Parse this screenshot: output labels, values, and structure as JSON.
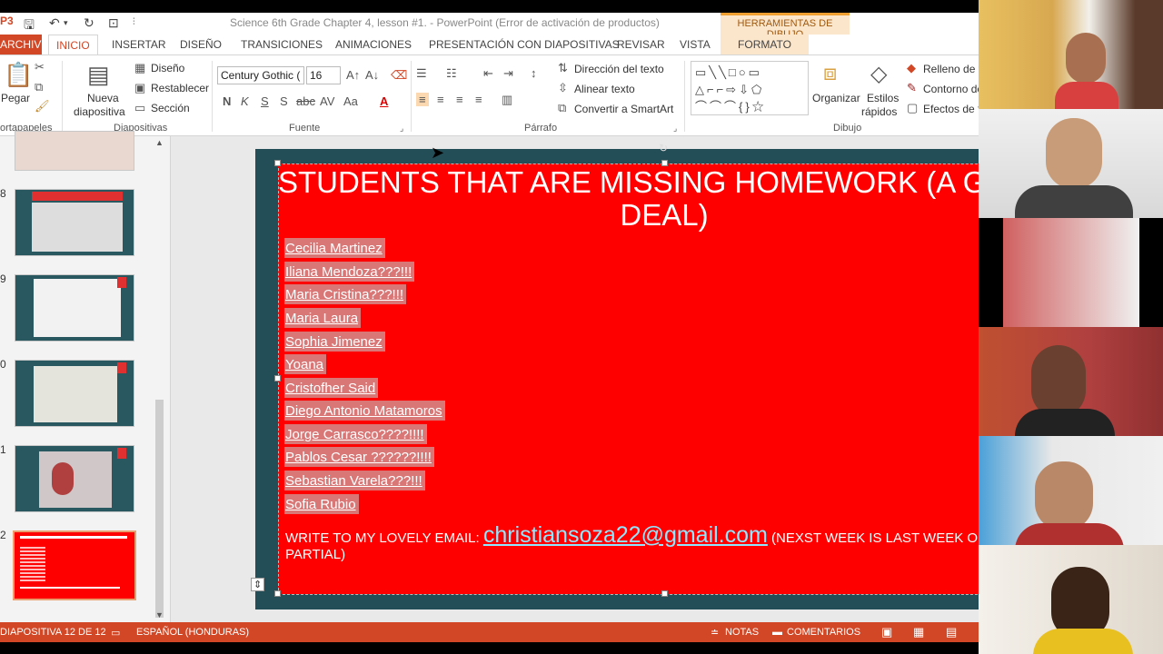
{
  "window": {
    "title": "Science 6th Grade Chapter 4, lesson #1. - PowerPoint (Error de activación de productos)",
    "app_icon": "P3"
  },
  "context_tab": {
    "header": "HERRAMIENTAS DE DIBUJO",
    "tab": "FORMATO"
  },
  "tabs": [
    "ARCHIVO",
    "INICIO",
    "INSERTAR",
    "DISEÑO",
    "TRANSICIONES",
    "ANIMACIONES",
    "PRESENTACIÓN CON DIAPOSITIVAS",
    "REVISAR",
    "VISTA"
  ],
  "ribbon": {
    "paste": "Pegar",
    "clipboard_label": "ortapapeles",
    "new_slide_1": "Nueva",
    "new_slide_2": "diapositiva",
    "layout": "Diseño",
    "reset": "Restablecer",
    "section": "Sección",
    "slides_label": "Diapositivas",
    "font_name": "Century Gothic (",
    "font_size": "16",
    "font_label": "Fuente",
    "text_direction": "Dirección del texto",
    "align_text": "Alinear texto",
    "smartart": "Convertir a SmartArt",
    "paragraph_label": "Párrafo",
    "arrange": "Organizar",
    "quick_styles_1": "Estilos",
    "quick_styles_2": "rápidos",
    "fill": "Relleno de fo",
    "outline": "Contorno de",
    "effects": "Efectos de fo",
    "drawing_label": "Dibujo"
  },
  "thumbnails": [
    {
      "num": "",
      "partial": true
    },
    {
      "num": "8"
    },
    {
      "num": "9"
    },
    {
      "num": "0"
    },
    {
      "num": "1"
    },
    {
      "num": "2",
      "selected": true
    }
  ],
  "slide": {
    "title_line1": "STUDENTS THAT ARE MISSING HOMEWORK (A GREAT",
    "title_line2": "DEAL)",
    "students": [
      "Cecilia Martinez",
      "Iliana Mendoza???!!!",
      "Maria Cristina???!!!",
      "Maria Laura",
      "Sophia Jimenez",
      "Yoana",
      "Cristofher Said",
      "Diego Antonio Matamoros",
      "Jorge Carrasco????!!!!",
      "Pablos Cesar ??????!!!!",
      "Sebastian Varela???!!!",
      "Sofia Rubio"
    ],
    "email_prefix": "WRITE TO MY LOVELY EMAIL: ",
    "email": "christiansoza22@gmail.com",
    "email_suffix": "  (NEXST WEEK IS LAST WEEK OF",
    "email_line2": "PARTIAL)"
  },
  "status": {
    "slide_counter": "DIAPOSITIVA 12 DE 12",
    "language": "ESPAÑOL (HONDURAS)",
    "notes": "NOTAS",
    "comments": "COMENTARIOS"
  },
  "colors": {
    "accent": "#d24726",
    "slide_red": "#ff0000",
    "slide_frame": "#244e57",
    "link": "#8fe8ff"
  }
}
